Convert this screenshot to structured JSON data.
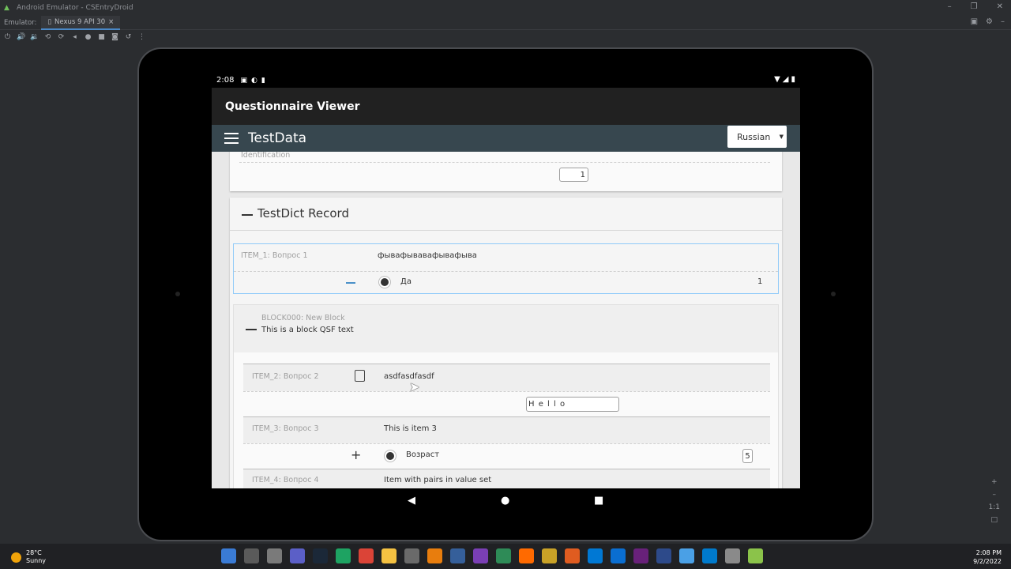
{
  "window": {
    "title": "Android Emulator - CSEntryDroid"
  },
  "tabs": {
    "label": "Emulator:",
    "active_tab": "Nexus 9 API 30"
  },
  "device": {
    "status": {
      "time": "2:08"
    },
    "appbar_title": "Questionnaire Viewer",
    "header": {
      "title": "TestData",
      "language": "Russian"
    }
  },
  "form": {
    "top_card": {
      "label": "Identification",
      "value": "1"
    },
    "record": {
      "title": "TestDict Record"
    },
    "item1": {
      "label": "ITEM_1: Вопрос 1",
      "text": "фывафывавафывафыва",
      "option": "Да",
      "value": "1"
    },
    "block": {
      "label": "BLOCK000: New Block",
      "text": "This is a block QSF text"
    },
    "item2": {
      "label": "ITEM_2: Вопрос 2",
      "text": "asdfasdfasdf",
      "value": "H e l l o"
    },
    "item3": {
      "label": "ITEM_3: Вопрос 3",
      "text": "This is item 3",
      "option": "Возраст",
      "value": "5"
    },
    "item4": {
      "label": "ITEM_4: Вопрос 4",
      "text": "Item with pairs in value set"
    }
  },
  "taskbar": {
    "temp": "28°C",
    "condition": "Sunny",
    "time": "2:08 PM",
    "date": "9/2/2022",
    "icon_colors": [
      "#3a7bd5",
      "#5a5a5a",
      "#7a7a7a",
      "#5b5fc7",
      "#1b2838",
      "#1ea362",
      "#db4437",
      "#f5c242",
      "#6a6a6a",
      "#e87d0d",
      "#355f9a",
      "#7a3fb5",
      "#2e8b57",
      "#ff6a00",
      "#c9a227",
      "#e05c20",
      "#0078d4",
      "#0a6ed1",
      "#68217a",
      "#2d4a8a",
      "#4aa0e6",
      "#007acc",
      "#8a8a8a",
      "#8bc34a"
    ]
  }
}
